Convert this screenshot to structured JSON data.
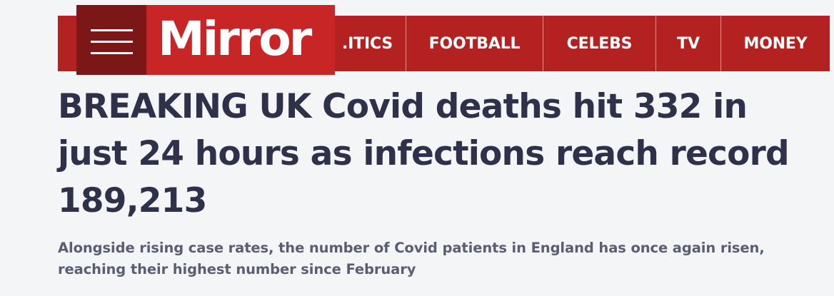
{
  "brand": {
    "logo_text": "Mirror",
    "menu_icon": "hamburger-menu-icon"
  },
  "nav": {
    "items": [
      {
        "label": ".ITICS"
      },
      {
        "label": "FOOTBALL"
      },
      {
        "label": "CELEBS"
      },
      {
        "label": "TV"
      },
      {
        "label": "MONEY"
      }
    ]
  },
  "article": {
    "headline": "BREAKING UK Covid deaths hit 332 in just 24 hours as infections reach record 189,213",
    "standfirst": "Alongside rising case rates, the number of Covid patients in England has once again risen, reaching their highest number since February"
  },
  "colors": {
    "nav_red": "#b32121",
    "brand_red": "#c82626",
    "menu_dark_red": "#7b1717",
    "headline_text": "#2f304a",
    "standfirst_text": "#5b5d72",
    "page_background": "#f4f5f7"
  }
}
